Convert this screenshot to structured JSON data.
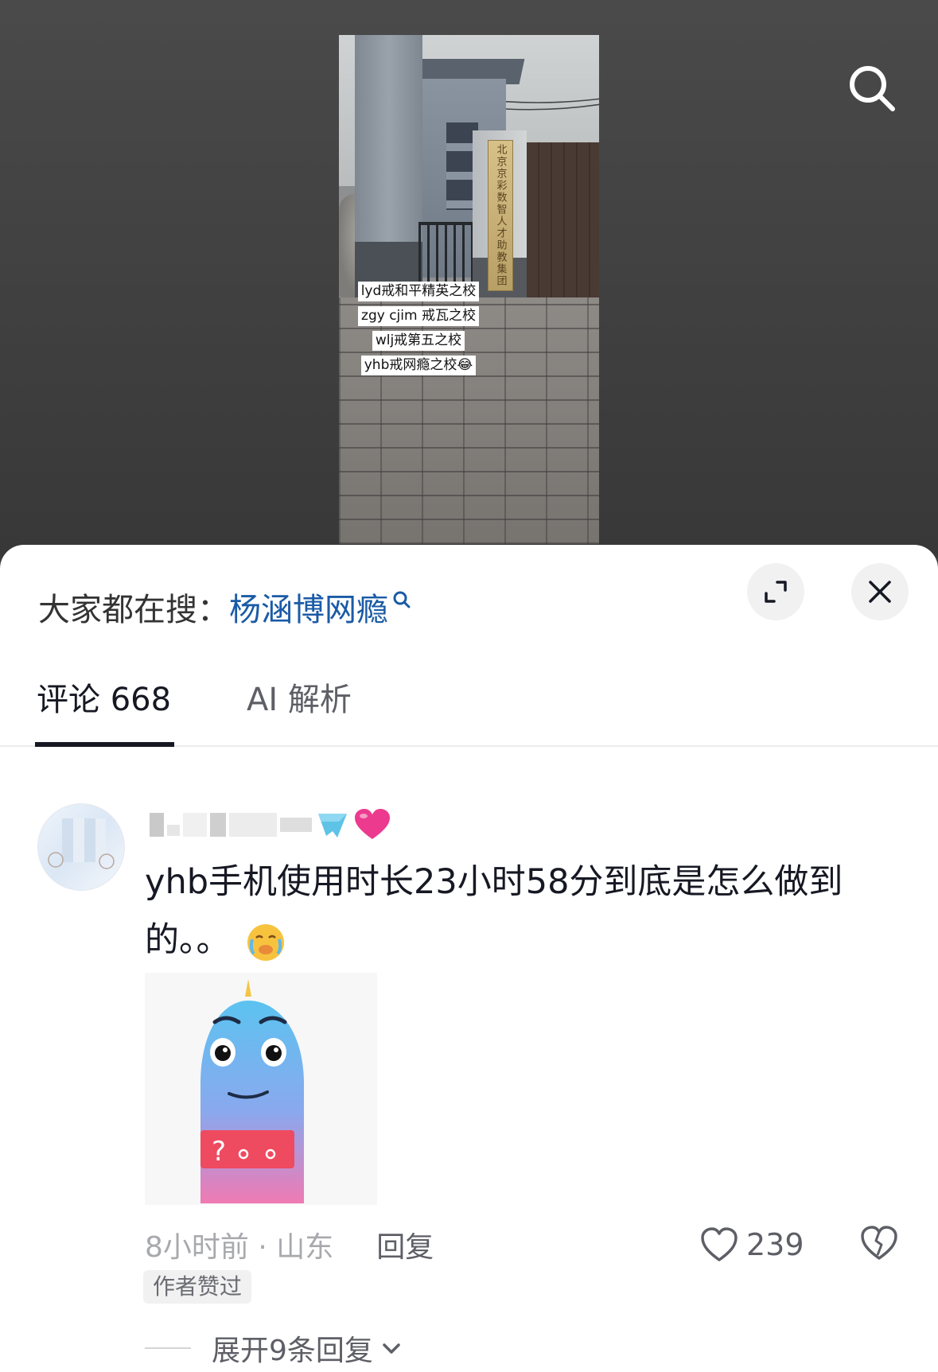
{
  "video": {
    "plaque_text": "北京京彩数智人才助教集团",
    "captions": [
      "lyd戒和平精英之校",
      "zgy cjim 戒瓦之校",
      "wlj戒第五之校",
      "yhb戒网瘾之校😂"
    ]
  },
  "icons": {
    "search": "search-icon",
    "expand": "expand-icon",
    "close": "close-icon",
    "hot_search": "search-small-icon",
    "like": "heart-outline-icon",
    "dislike": "broken-heart-icon",
    "chevron": "chevron-down-icon"
  },
  "sheet": {
    "hot_search_label": "大家都在搜：",
    "hot_search_term": "杨涵博网瘾",
    "tabs": [
      {
        "label": "评论 668",
        "active": true
      },
      {
        "label": "AI 解析",
        "active": false
      }
    ],
    "comment": {
      "text_part1": "yhb手机使用时长23小时58分到底是怎么做到的。。",
      "time_location": "8小时前 · 山东",
      "reply_label": "回复",
      "likes": "239",
      "author_badge": "作者赞过",
      "expand_replies": "展开9条回复"
    }
  },
  "colors": {
    "hot_term": "#1a5ba6",
    "text_primary": "#161823",
    "text_secondary": "#5e5f66",
    "text_muted": "#a8a9ad",
    "sheet_bg": "#ffffff",
    "video_bg": "#3d3d3d"
  }
}
